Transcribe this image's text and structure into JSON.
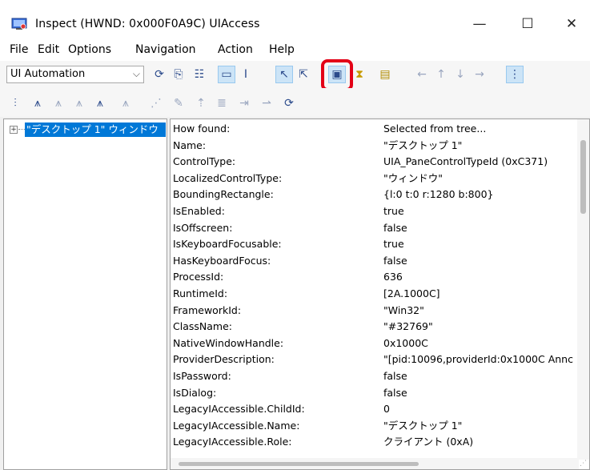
{
  "window": {
    "title": "Inspect  (HWND: 0x000F0A9C) UIAccess",
    "caption": {
      "minimize": "—",
      "maximize": "☐",
      "close": "✕"
    }
  },
  "menu": [
    {
      "label": "File"
    },
    {
      "label": "Edit"
    },
    {
      "label": "Options"
    },
    {
      "label": "Navigation"
    },
    {
      "label": "Action"
    },
    {
      "label": "Help"
    }
  ],
  "toolbar": {
    "mode_select": {
      "value": "UI Automation"
    }
  },
  "tree": {
    "selected_node": "\"デスクトップ 1\" ウィンドウ"
  },
  "properties": [
    {
      "name": "How found:",
      "value": "Selected from tree..."
    },
    {
      "name": "Name:",
      "value": "\"デスクトップ 1\""
    },
    {
      "name": "ControlType:",
      "value": "UIA_PaneControlTypeId (0xC371)"
    },
    {
      "name": "LocalizedControlType:",
      "value": "\"ウィンドウ\""
    },
    {
      "name": "BoundingRectangle:",
      "value": "{l:0 t:0 r:1280 b:800}"
    },
    {
      "name": "IsEnabled:",
      "value": "true"
    },
    {
      "name": "IsOffscreen:",
      "value": "false"
    },
    {
      "name": "IsKeyboardFocusable:",
      "value": "true"
    },
    {
      "name": "HasKeyboardFocus:",
      "value": "false"
    },
    {
      "name": "ProcessId:",
      "value": "636"
    },
    {
      "name": "RuntimeId:",
      "value": "[2A.1000C]"
    },
    {
      "name": "FrameworkId:",
      "value": "\"Win32\""
    },
    {
      "name": "ClassName:",
      "value": "\"#32769\""
    },
    {
      "name": "NativeWindowHandle:",
      "value": "0x1000C"
    },
    {
      "name": "ProviderDescription:",
      "value": "\"[pid:10096,providerId:0x1000C Annc"
    },
    {
      "name": "IsPassword:",
      "value": "false"
    },
    {
      "name": "IsDialog:",
      "value": "false"
    },
    {
      "name": "LegacyIAccessible.ChildId:",
      "value": "0"
    },
    {
      "name": "LegacyIAccessible.Name:",
      "value": "\"デスクトップ 1\""
    },
    {
      "name": "LegacyIAccessible.Role:",
      "value": "クライアント (0xA)"
    }
  ]
}
